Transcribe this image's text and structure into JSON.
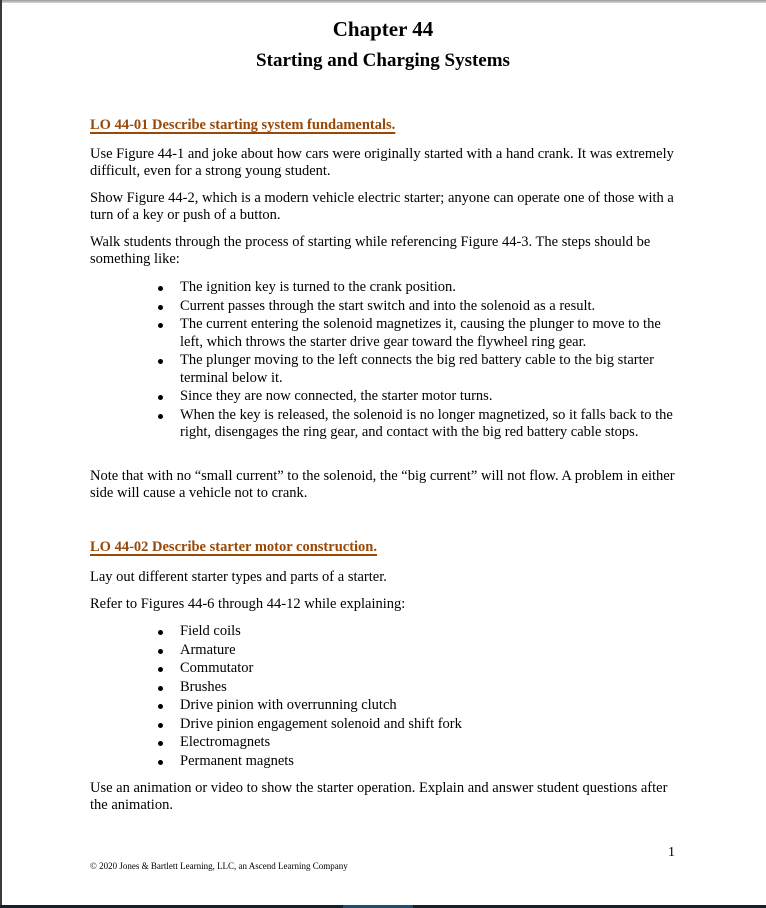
{
  "document": {
    "chapter_title": "Chapter 44",
    "chapter_subtitle": "Starting and Charging Systems",
    "heading_color": "#984807",
    "sections": [
      {
        "heading": "LO 44-01 Describe starting system fundamentals.",
        "paragraphs": [
          "Use Figure 44-1 and joke about how cars were originally started with a hand crank. It was extremely difficult, even for a strong young student.",
          "Show Figure 44-2, which is a modern vehicle electric starter; anyone can operate one of those with a turn of a key or push of a button.",
          "Walk students through the process of starting while referencing Figure 44-3. The steps should be something like:"
        ],
        "bullets": [
          "The ignition key is turned to the crank position.",
          "Current passes through the start switch and into the solenoid as a result.",
          "The current entering the solenoid magnetizes it, causing the plunger to move to the left, which throws the starter drive gear toward the flywheel ring gear.",
          "The plunger moving to the left connects the big red battery cable to the big starter terminal below it.",
          "Since they are now connected, the starter motor turns.",
          "When the key is released, the solenoid is no longer magnetized, so it falls back to the right, disengages the ring gear, and contact with the big red battery cable stops."
        ],
        "closing_paragraph": "Note that with no “small current” to the solenoid, the “big current” will not flow. A problem in either side will cause a vehicle not to crank."
      },
      {
        "heading": "LO 44-02 Describe starter motor construction.",
        "paragraphs": [
          "Lay out different starter types and parts of a starter.",
          "Refer to Figures 44-6 through 44-12 while explaining:"
        ],
        "bullets": [
          "Field coils",
          "Armature",
          "Commutator",
          "Brushes",
          "Drive pinion with overrunning clutch",
          "Drive pinion engagement solenoid and shift fork",
          "Electromagnets",
          "Permanent magnets"
        ],
        "closing_paragraph": "Use an animation or video to show the starter operation. Explain and answer student questions after the animation."
      }
    ],
    "footer": {
      "copyright": "© 2020 Jones & Bartlett Learning, LLC, an Ascend Learning Company",
      "page_number": "1"
    }
  }
}
